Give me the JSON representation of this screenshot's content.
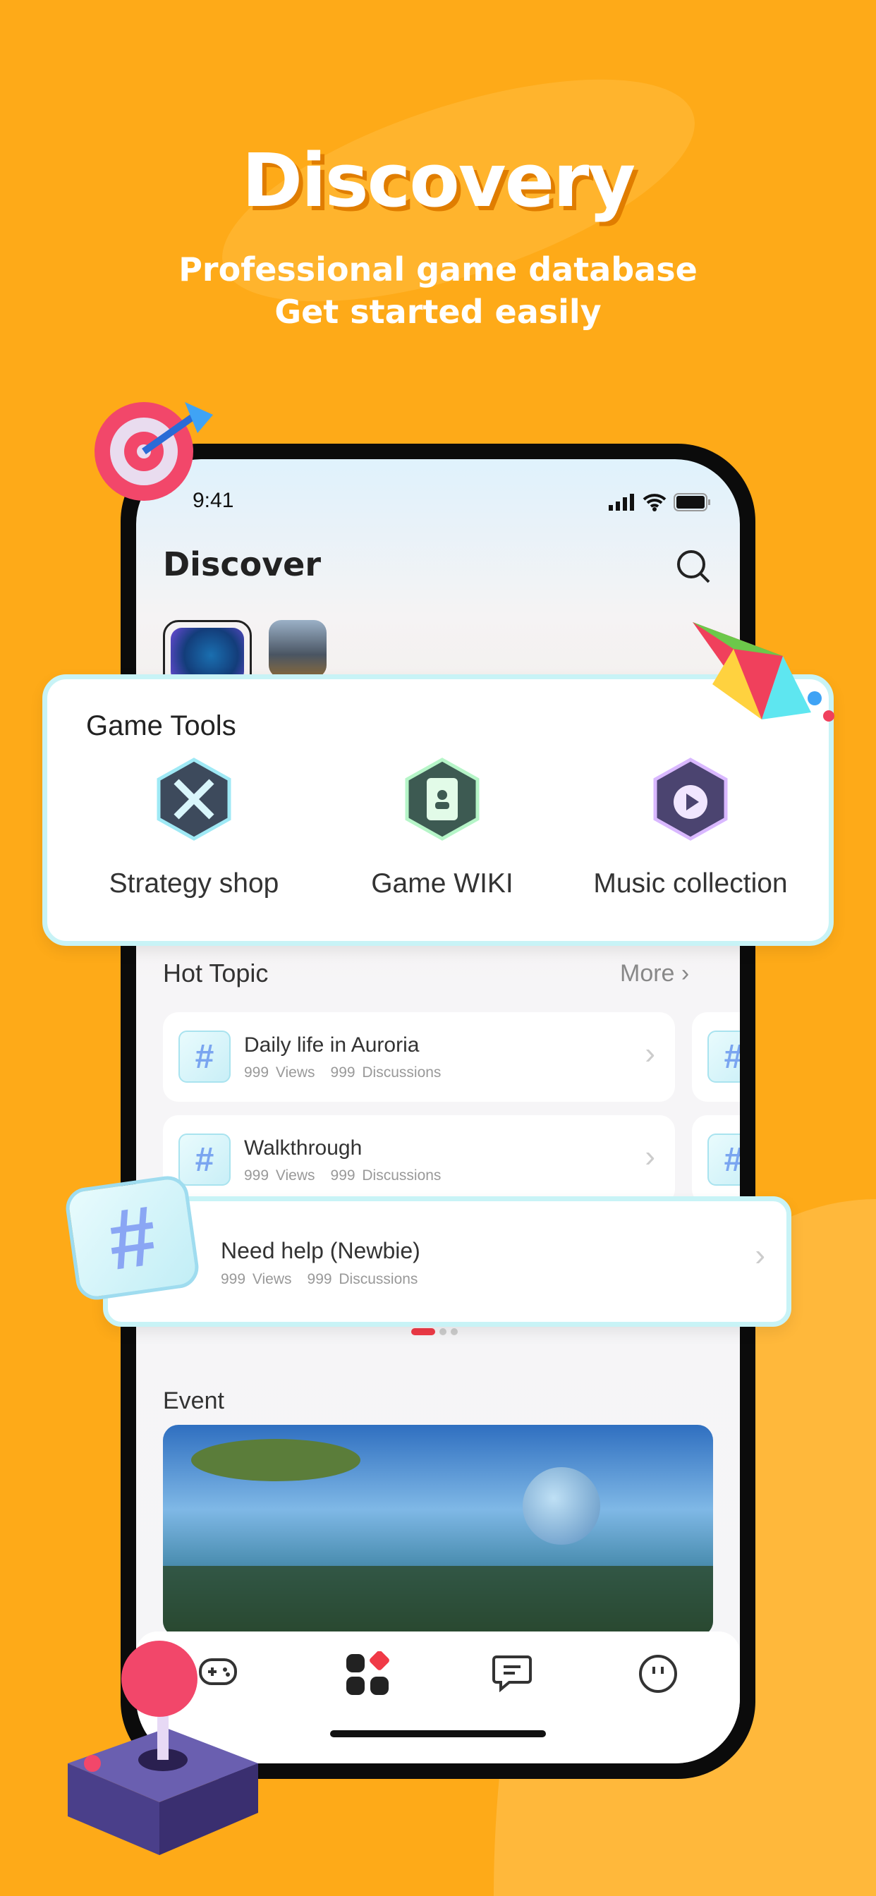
{
  "hero": {
    "title": "Discovery",
    "subtitle_line1": "Professional game database",
    "subtitle_line2": "Get started easily"
  },
  "colors": {
    "background": "#FEAA18",
    "accent_red": "#F03A47",
    "card_border": "#C8F3F6"
  },
  "status_bar": {
    "time": "9:41",
    "icons": [
      "signal-icon",
      "wifi-icon",
      "battery-icon"
    ]
  },
  "header": {
    "title": "Discover",
    "search_icon": "search-icon"
  },
  "games": [
    {
      "name": "astronaut-game-icon"
    },
    {
      "name": "zombie-shooter-game-icon"
    }
  ],
  "game_tools": {
    "title": "Game Tools",
    "items": [
      {
        "label": "Strategy shop",
        "icon": "crossed-swords-icon"
      },
      {
        "label": "Game WIKI",
        "icon": "book-icon"
      },
      {
        "label": "Music collection",
        "icon": "music-note-icon"
      }
    ]
  },
  "hot_topic": {
    "title": "Hot Topic",
    "more": "More",
    "items": [
      {
        "title": "Daily life in Auroria",
        "views": "999 Views",
        "discussions": "999 Discussions"
      },
      {
        "title": "Walkthrough",
        "views": "999 Views",
        "discussions": "999 Discussions"
      },
      {
        "title": "Need help (Newbie)",
        "views": "999 Views",
        "discussions": "999 Discussions"
      }
    ]
  },
  "event": {
    "title": "Event"
  },
  "tabbar": {
    "items": [
      {
        "icon": "gamepad-icon"
      },
      {
        "icon": "discover-grid-icon",
        "active": true
      },
      {
        "icon": "message-icon"
      },
      {
        "icon": "profile-icon"
      }
    ]
  }
}
